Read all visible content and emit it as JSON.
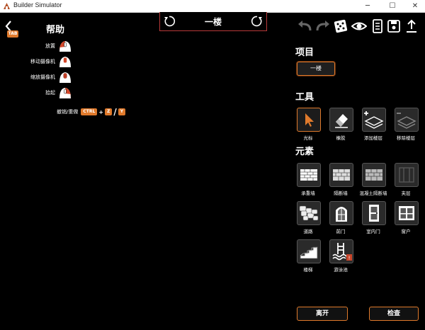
{
  "window": {
    "title": "Builder Simulator"
  },
  "help": {
    "tab_key": "TAB",
    "title": "帮助",
    "rows": [
      {
        "label": "放置"
      },
      {
        "label": "移动摄像机"
      },
      {
        "label": "缩放摄像机"
      },
      {
        "label": "拾起"
      }
    ],
    "undo_redo": {
      "label": "撤销/重做",
      "ctrl": "CTRL",
      "plus": "+",
      "z": "Z",
      "slash": "/",
      "y": "Y"
    }
  },
  "floor_selector": {
    "current": "一楼"
  },
  "sections": {
    "items": {
      "title": "项目",
      "floor_button": "一楼"
    },
    "tools": {
      "title": "工具",
      "items": [
        {
          "label": "光标",
          "icon": "cursor-icon",
          "selected": true
        },
        {
          "label": "橡胶",
          "icon": "eraser-icon",
          "selected": false
        },
        {
          "label": "添加楼层",
          "icon": "add-layer-icon",
          "selected": false
        },
        {
          "label": "移除楼层",
          "icon": "remove-layer-icon",
          "selected": false
        }
      ]
    },
    "elements": {
      "title": "元素",
      "items": [
        {
          "label": "承重墙",
          "icon": "bearing-wall-icon"
        },
        {
          "label": "隔断墙",
          "icon": "partition-wall-icon"
        },
        {
          "label": "混凝土隔断墙",
          "icon": "concrete-wall-icon"
        },
        {
          "label": "夹层",
          "icon": "mezzanine-icon"
        },
        {
          "label": "道路",
          "icon": "road-icon"
        },
        {
          "label": "前门",
          "icon": "front-door-icon"
        },
        {
          "label": "室内门",
          "icon": "interior-door-icon"
        },
        {
          "label": "窗户",
          "icon": "window-icon"
        },
        {
          "label": "楼梯",
          "icon": "stairs-icon"
        },
        {
          "label": "游泳池",
          "icon": "pool-icon"
        }
      ]
    }
  },
  "footer": {
    "leave": "离开",
    "inspect": "检查"
  },
  "colors": {
    "accent": "#e07a2c",
    "frame_red": "#b83a3a",
    "background": "#000000"
  }
}
